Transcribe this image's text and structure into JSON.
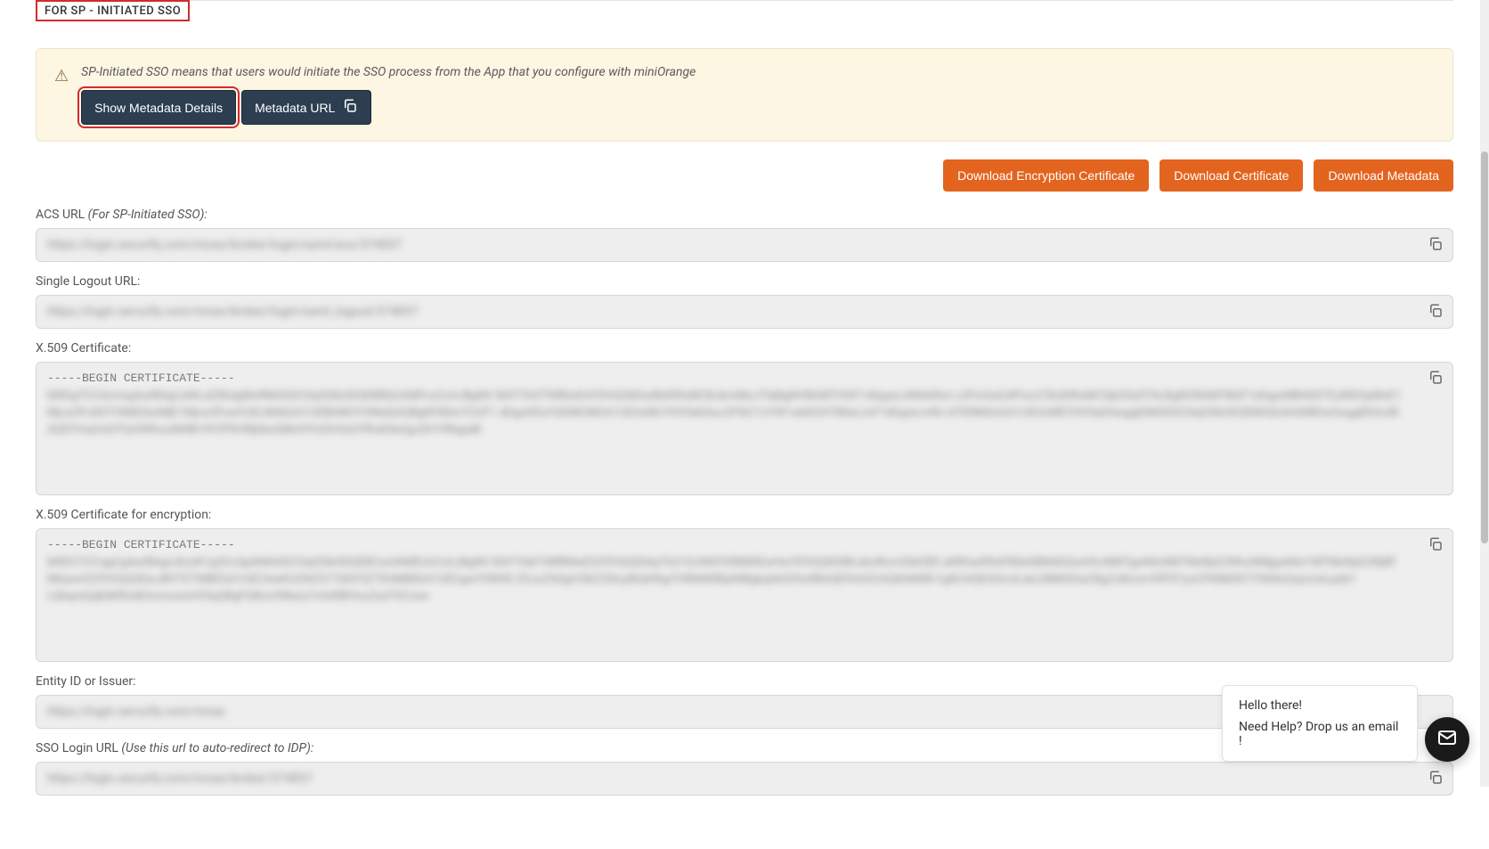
{
  "section_title": "FOR SP - INITIATED SSO",
  "info": {
    "text": "SP-Initiated SSO means that users would initiate the SSO process from the App that you configure with miniOrange",
    "show_metadata_label": "Show Metadata Details",
    "metadata_url_label": "Metadata URL"
  },
  "downloads": {
    "enc_cert": "Download Encryption Certificate",
    "cert": "Download Certificate",
    "metadata": "Download Metadata"
  },
  "fields": {
    "acs_url": {
      "label": "ACS URL",
      "label_suffix": " (For SP-Initiated SSO):",
      "value": "https://login.xecurify.com/moas/broker/login/saml/acs/374837"
    },
    "slo_url": {
      "label": "Single Logout URL:",
      "value": "https://login.xecurify.com/moas/broker/login/saml_logout/374837"
    },
    "x509": {
      "label": "X.509 Certificate:",
      "begin": "-----BEGIN CERTIFICATE-----",
      "body": "MIIDgTCCAmmgAwIBAgIJAKLdZ8UigMnRMA0GCSqGSIb3DQEBBQUAMFcxCzAJBgNV\nBAYTAlVTMRIwEAYDVQQKEwlBdXRoMCBJbmMxJTAjBgNVBAMTHGF1dGgwLnNhbWwt\nc2FtcGxlLWFwcC5hdXRoMC5jb20xDTALBgNVBAMTBGF1dGgwMB4XDTEzMDQyMzE1\nMjcxOFoXDTI3MDQwMjE1MjcxOFowVzELMAkGA1UEBhMCVVMxEjAQBgNVBAoTCUF1\ndGgwIEluYzElMCMGA1UEAxMcYXV0aDAuc2FtbC1zYW1wbGUtYXBwLmF1dGgwLmNv\nbTENMAsGA1UEAxMEYXV0aDAwggEiMA0GCSqGSIb3DQEBAQUAA4IBDwAwggEKAoIB\nAQDYmqVx6VYpVN9vuzM4B+9VZPbVBj6bxQ8kA5YzGH3sUYRraDteUgzZb1HRqpaB"
    },
    "x509_enc": {
      "label": "X.509 Certificate for encryption:",
      "begin": "-----BEGIN CERTIFICATE-----",
      "body": "MIIDCTCCagCgAwIBAgIJALkK1g3CcQpXMA0GCSqGSIb3DQEBCwUAMEUxCzAJBgNV\nBAYTAkFVMRMwEQYDVQQIDApTb21lLVN0YXRlMSEwHwYDVQQKDBhJbnRlcm5ldCBX\naWRnaXRzIFB0eSBMdGQwHhcNMTgwMzI4MTMzNjA2WhcNMjgwMzI1MTMzNjA2WjBF\nMQswCQYDVQQGEwJBVTETMBEGA1UECAwKU29tZS1TdGF0ZTEhMB8GA1UECgwYSW50\nZXJuZXQgV2lkZ2l0cyBQdHkgTHRkMIIBIjANBgkqhkiG9w0BAQEFAAOCAQ8AMIIB\nCgKCAQEA0vLKJaLGBMQfxeZ8gZcBcLk+f0PX7yxCP0l8kEK7YX8AhZqxcUoLpbk1\nLQkqwQqBdKRUdEAcmxzwUVSqQBgFQBxzVMasLFc0zRBHnuZszF3CLbw"
    },
    "entity_id": {
      "label": "Entity ID or Issuer:",
      "value": "https://login.xecurify.com/moas"
    },
    "sso_login": {
      "label": "SSO Login URL",
      "label_suffix": " (Use this url to auto-redirect to IDP):",
      "value": "https://login.xecurify.com/moas/broker/374837"
    }
  },
  "chat": {
    "greeting": "Hello there!",
    "help": "Need Help? Drop us an email !"
  }
}
